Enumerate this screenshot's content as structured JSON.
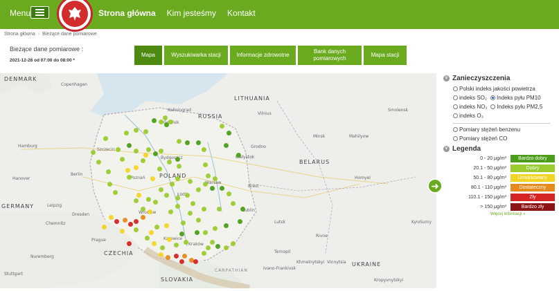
{
  "header": {
    "menu_label": "Menu",
    "nav": [
      "Strona główna",
      "Kim jesteśmy",
      "Kontakt"
    ]
  },
  "breadcrumb": [
    "Strona główna",
    "Bieżące dane pomiarowe"
  ],
  "page": {
    "subtitle": "Bieżące dane pomiarowe :",
    "date_range": "2021-12-28 od 07:00 do 08:00 *"
  },
  "tabs": [
    {
      "label": "Mapa",
      "active": true
    },
    {
      "label": "Wyszukiwarka stacji"
    },
    {
      "label": "Informacje zdrowotne"
    },
    {
      "label": "Bank danych pomiarowych"
    },
    {
      "label": "Mapa stacji"
    }
  ],
  "map": {
    "countries": [
      "DENMARK",
      "LITHUANIA",
      "RUSSIA",
      "BELARUS",
      "POLAND",
      "GERMANY",
      "CZECHIA",
      "UKRAINE",
      "SLOVAKIA",
      "CARPATHIAN"
    ],
    "cities": [
      "Copenhagen",
      "Kaliningrad",
      "Vilnius",
      "Gdańsk",
      "Szczecin",
      "Bydgoszcz",
      "Hamburg",
      "Berlin",
      "Hanover",
      "Poznań",
      "Warsaw",
      "Białystok",
      "Grodno",
      "Minsk",
      "Mahilyow",
      "Smolensk",
      "Brest",
      "Łódź",
      "Wrocław",
      "Leipzig",
      "Dresden",
      "Chemnitz",
      "Prague",
      "Lublin",
      "Lutsk",
      "Kyiv",
      "Homyel",
      "Rivne",
      "Ternopil",
      "Khmelnytskyi",
      "Vinnytsia",
      "Nuremberg",
      "Stuttgart",
      "Ivano-Frankivsk",
      "Kropyvnytskyi",
      "Kraków",
      "Katowice",
      "Sumy"
    ]
  },
  "panel": {
    "pollution_title": "Zanieczyszczenia",
    "options": [
      {
        "label": "Polski indeks jakości powietrza",
        "checked": false
      },
      {
        "label": "indeks SO₂",
        "checked": false
      },
      {
        "label": "Indeks pyłu PM10",
        "checked": true
      },
      {
        "label": "indeks NO₂",
        "checked": false
      },
      {
        "label": "Indeks pyłu PM2,5",
        "checked": false
      },
      {
        "label": "indeks O₃",
        "checked": false
      },
      {
        "label": "Pomiary stężeń benzenu",
        "checked": false
      },
      {
        "label": "Pomiary stężeń CO",
        "checked": false
      }
    ],
    "legend_title": "Legenda",
    "legend": [
      {
        "range": "0 - 20 μg/m³",
        "label": "Bardzo dobry",
        "color": "#4c9e1a"
      },
      {
        "range": "20.1 - 50 μg/m³",
        "label": "Dobry",
        "color": "#9bcb2f"
      },
      {
        "range": "50.1 - 80 μg/m³",
        "label": "Umiarkowany",
        "color": "#f2d523"
      },
      {
        "range": "80.1 - 110 μg/m³",
        "label": "Dostateczny",
        "color": "#e68a1c"
      },
      {
        "range": "110.1 - 150 μg/m³",
        "label": "Zły",
        "color": "#d52525"
      },
      {
        "range": "> 150 μg/m³",
        "label": "Bardzo zły",
        "color": "#8e1515"
      }
    ],
    "more_link": "Więcej informacji »"
  },
  "colors": {
    "brand": "#6aaa1e",
    "brand_dark": "#4c8a12"
  }
}
